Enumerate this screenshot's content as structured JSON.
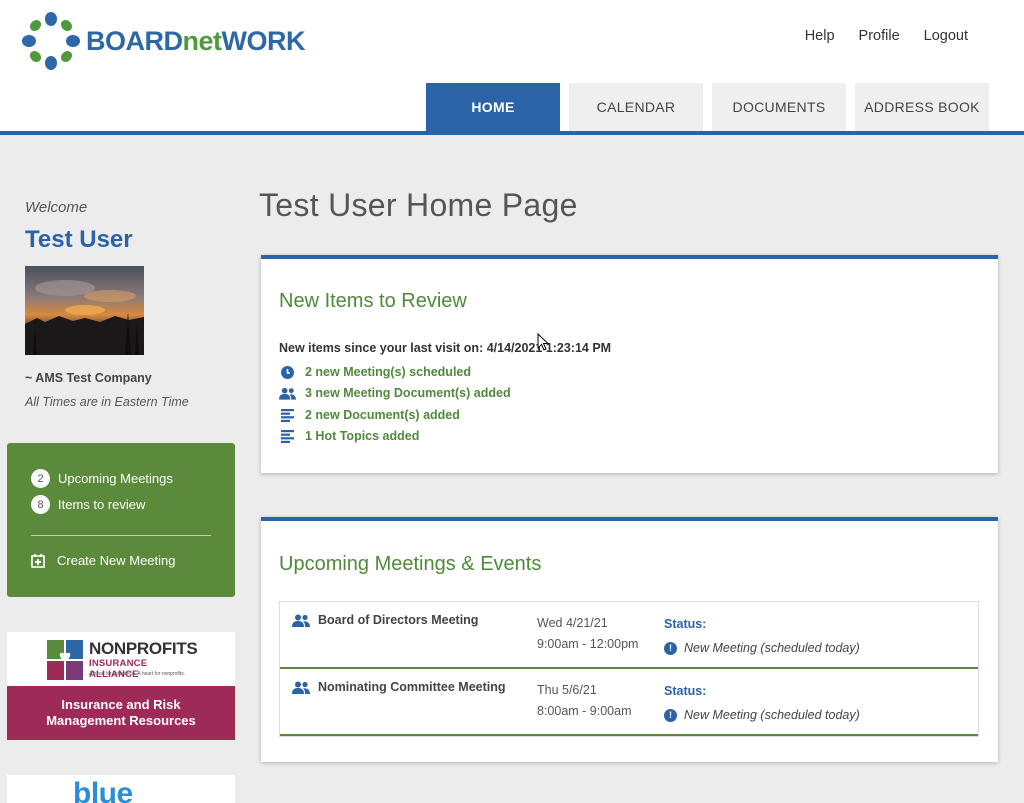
{
  "brand": {
    "logo_part1": "BOARD",
    "logo_part2": "net",
    "logo_part3": "WORK",
    "primary_color": "#2a63a8",
    "accent_green": "#5a8a3a"
  },
  "top_links": {
    "help": "Help",
    "profile": "Profile",
    "logout": "Logout"
  },
  "tabs": [
    {
      "label": "HOME",
      "active": true
    },
    {
      "label": "CALENDAR",
      "active": false
    },
    {
      "label": "DOCUMENTS",
      "active": false
    },
    {
      "label": "ADDRESS BOOK",
      "active": false
    }
  ],
  "sidebar": {
    "welcome": "Welcome",
    "user_name": "Test User",
    "company": "~ AMS Test Company",
    "timezone_note": "All Times are in Eastern Time",
    "summary": {
      "upcoming_count": "2",
      "upcoming_label": "Upcoming Meetings",
      "review_count": "8",
      "review_label": "Items to review",
      "create_label": "Create New Meeting"
    },
    "ad1": {
      "logo_line1": "NONPROFITS",
      "logo_line2": "INSURANCE ALLIANCE",
      "logo_tagline": "A head for insurance. A heart for nonprofits.",
      "band_line1": "Insurance and Risk",
      "band_line2": "Management Resources"
    },
    "ad2": {
      "text": "blue"
    }
  },
  "main": {
    "page_title": "Test User Home Page",
    "review": {
      "title": "New Items to Review",
      "since_text": "New items since your last visit on: 4/14/2021 1:23:14 PM",
      "items": [
        {
          "icon": "clock-icon",
          "label": "2 new Meeting(s) scheduled"
        },
        {
          "icon": "people-icon",
          "label": "3 new Meeting Document(s) added"
        },
        {
          "icon": "list-icon",
          "label": "2 new Document(s) added"
        },
        {
          "icon": "list-icon",
          "label": "1 Hot Topics added"
        }
      ]
    },
    "meetings": {
      "title": "Upcoming Meetings & Events",
      "rows": [
        {
          "name": "Board of Directors Meeting",
          "date": "Wed 4/21/21",
          "time": "9:00am - 12:00pm",
          "status_label": "Status:",
          "status": "New Meeting (scheduled today)"
        },
        {
          "name": "Nominating Committee Meeting",
          "date": "Thu 5/6/21",
          "time": "8:00am - 9:00am",
          "status_label": "Status:",
          "status": "New Meeting (scheduled today)"
        }
      ]
    }
  }
}
